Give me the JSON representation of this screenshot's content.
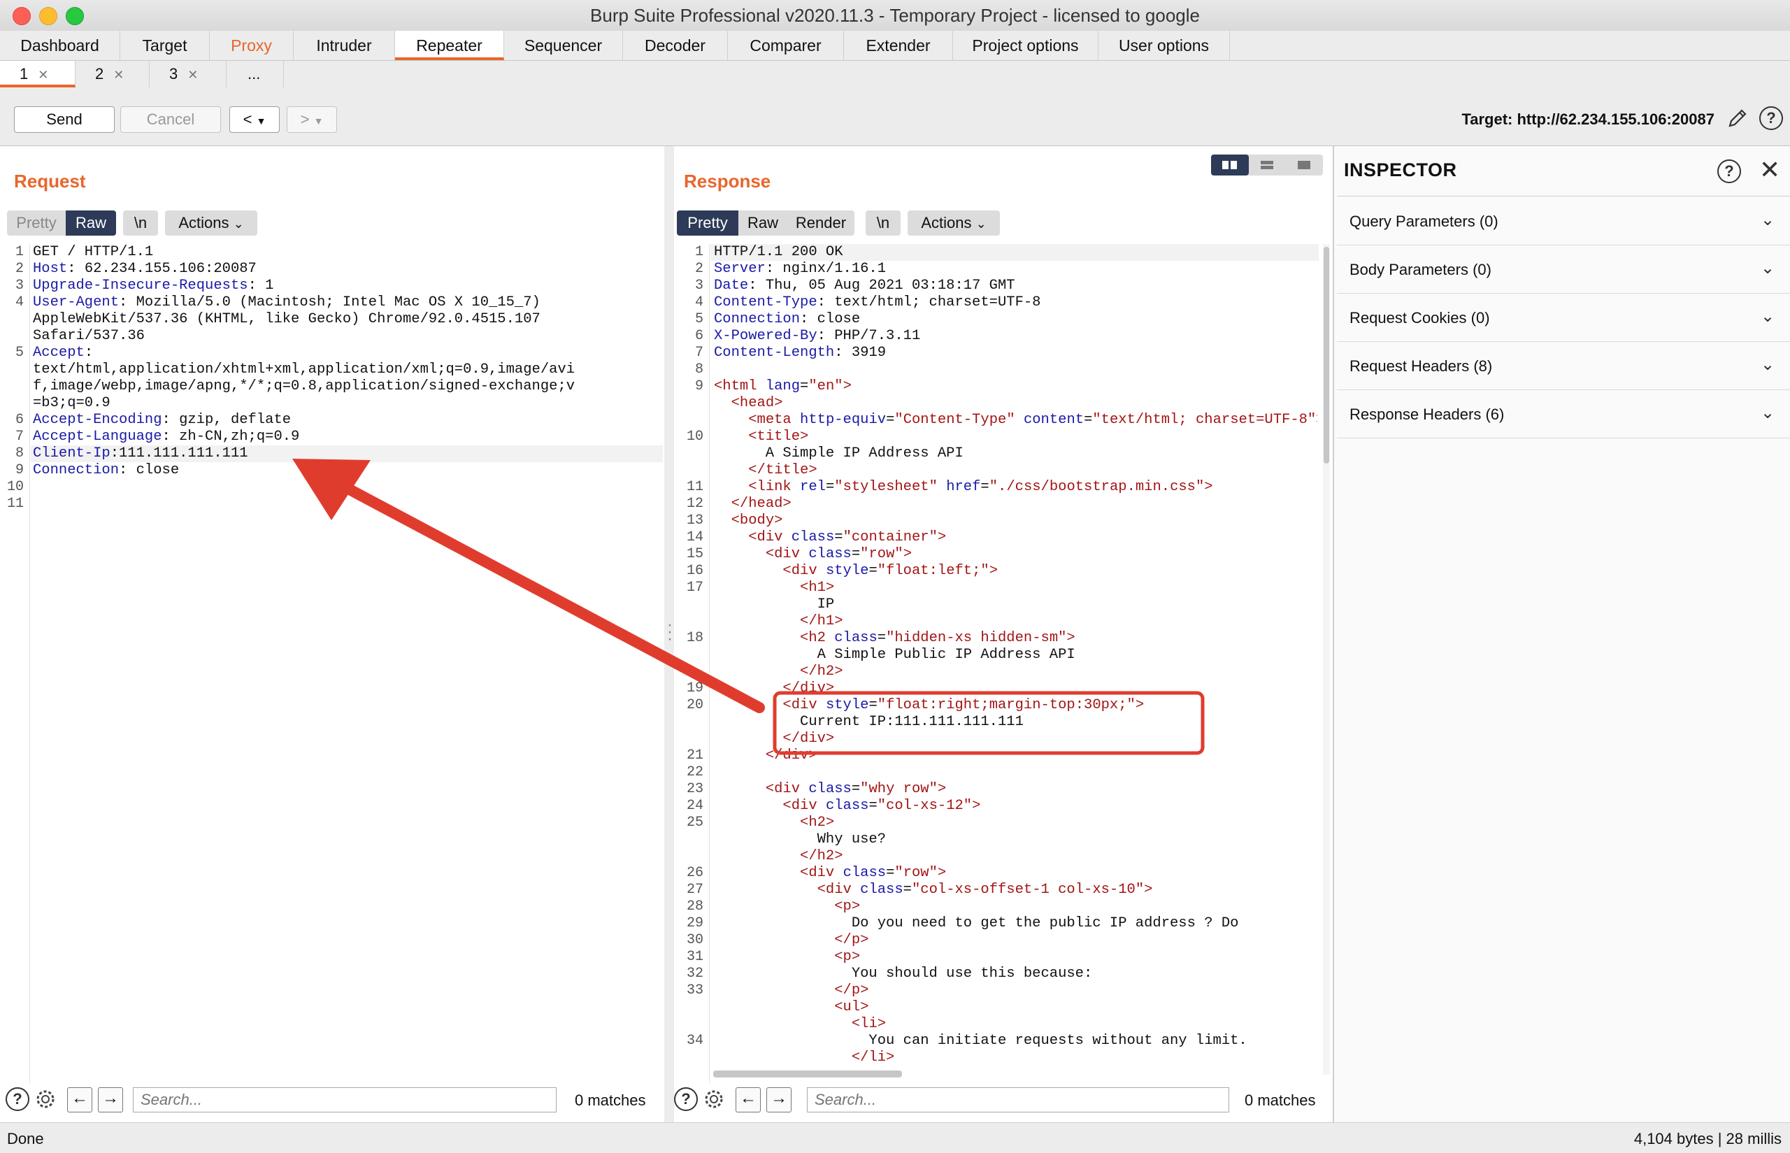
{
  "window": {
    "title": "Burp Suite Professional v2020.11.3 - Temporary Project - licensed to google"
  },
  "main_tabs": [
    "Dashboard",
    "Target",
    "Proxy",
    "Intruder",
    "Repeater",
    "Sequencer",
    "Decoder",
    "Comparer",
    "Extender",
    "Project options",
    "User options"
  ],
  "sub_tabs": [
    "1",
    "2",
    "3",
    "..."
  ],
  "toolbar": {
    "send": "Send",
    "cancel": "Cancel",
    "back": "<",
    "forward": ">",
    "target": "Target: http://62.234.155.106:20087"
  },
  "request": {
    "title": "Request",
    "view_buttons": {
      "pretty": "Pretty",
      "raw": "Raw",
      "newline": "\\n",
      "actions": "Actions"
    },
    "search_placeholder": "Search...",
    "matches": "0 matches"
  },
  "response": {
    "title": "Response",
    "view_buttons": {
      "pretty": "Pretty",
      "raw": "Raw",
      "render": "Render",
      "newline": "\\n",
      "actions": "Actions"
    },
    "search_placeholder": "Search...",
    "matches": "0 matches"
  },
  "inspector": {
    "title": "INSPECTOR",
    "sections": [
      "Query Parameters (0)",
      "Body Parameters (0)",
      "Request Cookies (0)",
      "Request Headers (8)",
      "Response Headers (6)"
    ]
  },
  "status": {
    "left": "Done",
    "right": "4,104 bytes | 28 millis"
  },
  "colors": {
    "accent": "#e8662c",
    "annotation": "#e03c2e",
    "selected_segment": "#2d3b58"
  }
}
